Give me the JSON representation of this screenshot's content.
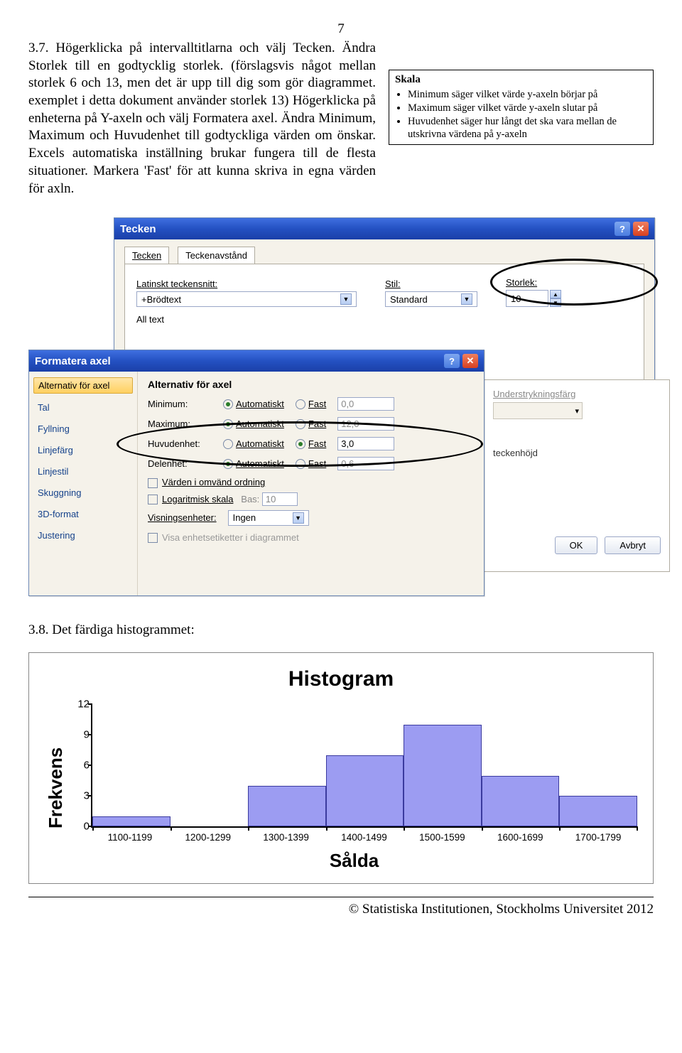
{
  "pageNumber": "7",
  "paragraph": "3.7. Högerklicka på intervalltitlarna och välj Tecken. Ändra Storlek till en godtycklig storlek. (förslagsvis något mellan storlek 6 och 13, men det är upp till dig som gör diagrammet. exemplet i detta dokument använder storlek 13) Högerklicka på enheterna på Y-axeln och välj Formatera axel. Ändra Minimum, Maximum och Huvudenhet till godtyckliga värden om önskar. Excels automatiska inställning brukar fungera till de flesta situationer. Markera 'Fast' för att kunna skriva in egna värden för axln.",
  "skala": {
    "title": "Skala",
    "items": [
      "Minimum säger vilket värde y-axeln börjar på",
      "Maximum säger vilket värde y-axeln slutar på",
      "Huvudenhet säger hur långt det ska vara mellan de utskrivna värdena på y-axeln"
    ]
  },
  "tecken": {
    "title": "Tecken",
    "tab1": "Tecken",
    "tab2": "Teckenavstånd",
    "latLabel": "Latinskt teckensnitt:",
    "latVal": "+Brödtext",
    "stilLabel": "Stil:",
    "stilVal": "Standard",
    "storlekLabel": "Storlek:",
    "storlekVal": "10",
    "allText": "All text",
    "understrLabel": "Understrykningsfärg",
    "teckenhojd": "teckenhöjd",
    "ok": "OK",
    "avbryt": "Avbryt"
  },
  "format": {
    "title": "Formatera axel",
    "side": [
      "Alternativ för axel",
      "Tal",
      "Fyllning",
      "Linjefärg",
      "Linjestil",
      "Skuggning",
      "3D-format",
      "Justering"
    ],
    "heading": "Alternativ för axel",
    "rows": [
      {
        "label": "Minimum:",
        "autoOn": true,
        "val": "0,0"
      },
      {
        "label": "Maximum:",
        "autoOn": true,
        "val": "12,0"
      },
      {
        "label": "Huvudenhet:",
        "autoOn": false,
        "val": "3,0"
      },
      {
        "label": "Delenhet:",
        "autoOn": true,
        "val": "0,6"
      }
    ],
    "autoLabel": "Automatiskt",
    "fastLabel": "Fast",
    "chk1": "Värden i omvänd ordning",
    "chk2": "Logaritmisk skala",
    "bas": "Bas:",
    "basVal": "10",
    "visning": "Visningsenheter:",
    "visningVal": "Ingen",
    "chk3": "Visa enhetsetiketter i diagrammet"
  },
  "sec38": "3.8. Det färdiga histogrammet:",
  "chart_data": {
    "type": "bar",
    "title": "Histogram",
    "ylabel": "Frekvens",
    "xlabel": "Sålda",
    "categories": [
      "1100-1199",
      "1200-1299",
      "1300-1399",
      "1400-1499",
      "1500-1599",
      "1600-1699",
      "1700-1799"
    ],
    "values": [
      1,
      0,
      4,
      7,
      10,
      5,
      3
    ],
    "yticks": [
      0,
      3,
      6,
      9,
      12
    ],
    "ylim": [
      0,
      12
    ]
  },
  "footer": "© Statistiska Institutionen, Stockholms Universitet 2012"
}
